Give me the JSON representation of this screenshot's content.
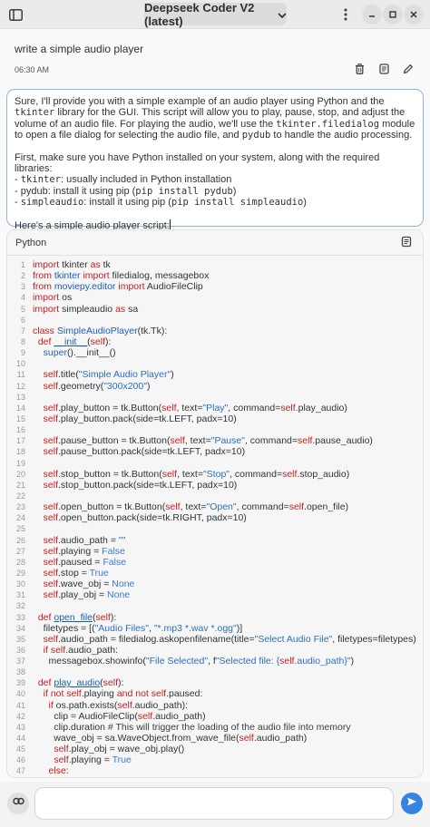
{
  "header": {
    "model_label": "Deepseek Coder V2 (latest)"
  },
  "user_message": {
    "text": "write a simple audio player",
    "time": "06:30 AM"
  },
  "assistant": {
    "p1_a": "Sure, I'll provide you with a simple example of an audio player using Python and the ",
    "p1_b": "tkinter",
    "p1_c": " library for the GUI. This script will allow you to play, pause, stop, and adjust the volume of an audio file. For playing the audio, we'll use the ",
    "p1_d": "tkinter.filedialog",
    "p1_e": " module to open a file dialog for selecting the audio file, and ",
    "p1_f": "pydub",
    "p1_g": " to handle the audio processing.",
    "p2": "First, make sure you have Python installed on your system, along with the required libraries:",
    "b1_a": "- ",
    "b1_b": "tkinter",
    "b1_c": ": usually included in Python installation",
    "b2_a": "- pydub: install it using pip (",
    "b2_b": "pip install pydub",
    "b2_c": ")",
    "b3_a": "- ",
    "b3_b": "simpleaudio",
    "b3_c": ": install it using pip (",
    "b3_d": "pip install simpleaudio",
    "b3_e": ")",
    "p3": "Here's a simple audio player script:"
  },
  "code_block": {
    "language": "Python",
    "lines": [
      [
        [
          "k",
          "import"
        ],
        [
          "p",
          " tkinter "
        ],
        [
          "k",
          "as"
        ],
        [
          "p",
          " tk"
        ]
      ],
      [
        [
          "k",
          "from"
        ],
        [
          "p",
          " "
        ],
        [
          "t",
          "tkinter"
        ],
        [
          "p",
          " "
        ],
        [
          "k",
          "import"
        ],
        [
          "p",
          " filedialog, messagebox"
        ]
      ],
      [
        [
          "k",
          "from"
        ],
        [
          "p",
          " "
        ],
        [
          "t",
          "moviepy.editor"
        ],
        [
          "p",
          " "
        ],
        [
          "k",
          "import"
        ],
        [
          "p",
          " AudioFileClip"
        ]
      ],
      [
        [
          "k",
          "import"
        ],
        [
          "p",
          " os"
        ]
      ],
      [
        [
          "k",
          "import"
        ],
        [
          "p",
          " simpleaudio "
        ],
        [
          "k",
          "as"
        ],
        [
          "p",
          " sa"
        ]
      ],
      [],
      [
        [
          "k",
          "class"
        ],
        [
          "p",
          " "
        ],
        [
          "t",
          "SimpleAudioPlayer"
        ],
        [
          "p",
          "(tk.Tk):"
        ]
      ],
      [
        [
          "p",
          "  "
        ],
        [
          "k",
          "def"
        ],
        [
          "p",
          " "
        ],
        [
          "fname",
          "__init__"
        ],
        [
          "p",
          "("
        ],
        [
          "k",
          "self"
        ],
        [
          "p",
          "):"
        ]
      ],
      [
        [
          "p",
          "    "
        ],
        [
          "fn",
          "super"
        ],
        [
          "p",
          "().__init__()"
        ]
      ],
      [],
      [
        [
          "p",
          "    "
        ],
        [
          "k",
          "self"
        ],
        [
          "p",
          ".title("
        ],
        [
          "s",
          "\"Simple Audio Player\""
        ],
        [
          "p",
          ")"
        ]
      ],
      [
        [
          "p",
          "    "
        ],
        [
          "k",
          "self"
        ],
        [
          "p",
          ".geometry("
        ],
        [
          "s",
          "\"300x200\""
        ],
        [
          "p",
          ")"
        ]
      ],
      [],
      [
        [
          "p",
          "    "
        ],
        [
          "k",
          "self"
        ],
        [
          "p",
          ".play_button = tk.Button("
        ],
        [
          "k",
          "self"
        ],
        [
          "p",
          ", text="
        ],
        [
          "s",
          "\"Play\""
        ],
        [
          "p",
          ", command="
        ],
        [
          "k",
          "self"
        ],
        [
          "p",
          ".play_audio)"
        ]
      ],
      [
        [
          "p",
          "    "
        ],
        [
          "k",
          "self"
        ],
        [
          "p",
          ".play_button.pack(side=tk.LEFT, padx=10)"
        ]
      ],
      [],
      [
        [
          "p",
          "    "
        ],
        [
          "k",
          "self"
        ],
        [
          "p",
          ".pause_button = tk.Button("
        ],
        [
          "k",
          "self"
        ],
        [
          "p",
          ", text="
        ],
        [
          "s",
          "\"Pause\""
        ],
        [
          "p",
          ", command="
        ],
        [
          "k",
          "self"
        ],
        [
          "p",
          ".pause_audio)"
        ]
      ],
      [
        [
          "p",
          "    "
        ],
        [
          "k",
          "self"
        ],
        [
          "p",
          ".pause_button.pack(side=tk.LEFT, padx=10)"
        ]
      ],
      [],
      [
        [
          "p",
          "    "
        ],
        [
          "k",
          "self"
        ],
        [
          "p",
          ".stop_button = tk.Button("
        ],
        [
          "k",
          "self"
        ],
        [
          "p",
          ", text="
        ],
        [
          "s",
          "\"Stop\""
        ],
        [
          "p",
          ", command="
        ],
        [
          "k",
          "self"
        ],
        [
          "p",
          ".stop_audio)"
        ]
      ],
      [
        [
          "p",
          "    "
        ],
        [
          "k",
          "self"
        ],
        [
          "p",
          ".stop_button.pack(side=tk.LEFT, padx=10)"
        ]
      ],
      [],
      [
        [
          "p",
          "    "
        ],
        [
          "k",
          "self"
        ],
        [
          "p",
          ".open_button = tk.Button("
        ],
        [
          "k",
          "self"
        ],
        [
          "p",
          ", text="
        ],
        [
          "s",
          "\"Open\""
        ],
        [
          "p",
          ", command="
        ],
        [
          "k",
          "self"
        ],
        [
          "p",
          ".open_file)"
        ]
      ],
      [
        [
          "p",
          "    "
        ],
        [
          "k",
          "self"
        ],
        [
          "p",
          ".open_button.pack(side=tk.RIGHT, padx=10)"
        ]
      ],
      [],
      [
        [
          "p",
          "    "
        ],
        [
          "k",
          "self"
        ],
        [
          "p",
          ".audio_path = "
        ],
        [
          "s",
          "\"\""
        ]
      ],
      [
        [
          "p",
          "    "
        ],
        [
          "k",
          "self"
        ],
        [
          "p",
          ".playing = "
        ],
        [
          "n",
          "False"
        ]
      ],
      [
        [
          "p",
          "    "
        ],
        [
          "k",
          "self"
        ],
        [
          "p",
          ".paused = "
        ],
        [
          "n",
          "False"
        ]
      ],
      [
        [
          "p",
          "    "
        ],
        [
          "k",
          "self"
        ],
        [
          "p",
          ".stop = "
        ],
        [
          "n",
          "True"
        ]
      ],
      [
        [
          "p",
          "    "
        ],
        [
          "k",
          "self"
        ],
        [
          "p",
          ".wave_obj = "
        ],
        [
          "n",
          "None"
        ]
      ],
      [
        [
          "p",
          "    "
        ],
        [
          "k",
          "self"
        ],
        [
          "p",
          ".play_obj = "
        ],
        [
          "n",
          "None"
        ]
      ],
      [],
      [
        [
          "p",
          "  "
        ],
        [
          "k",
          "def"
        ],
        [
          "p",
          " "
        ],
        [
          "fname",
          "open_file"
        ],
        [
          "p",
          "("
        ],
        [
          "k",
          "self"
        ],
        [
          "p",
          "):"
        ]
      ],
      [
        [
          "p",
          "    filetypes = [("
        ],
        [
          "s",
          "\"Audio Files\""
        ],
        [
          "p",
          ", "
        ],
        [
          "s",
          "\"*.mp3 *.wav *.ogg\""
        ],
        [
          "p",
          ")]"
        ]
      ],
      [
        [
          "p",
          "    "
        ],
        [
          "k",
          "self"
        ],
        [
          "p",
          ".audio_path = filedialog.askopenfilename(title="
        ],
        [
          "s",
          "\"Select Audio File\""
        ],
        [
          "p",
          ", filetypes=filetypes)"
        ]
      ],
      [
        [
          "p",
          "    "
        ],
        [
          "k",
          "if self"
        ],
        [
          "p",
          ".audio_path:"
        ]
      ],
      [
        [
          "p",
          "      messagebox.showinfo("
        ],
        [
          "s",
          "\"File Selected\""
        ],
        [
          "p",
          ", f"
        ],
        [
          "s",
          "\"Selected file: {"
        ],
        [
          "k",
          "self"
        ],
        [
          "s",
          ".audio_path}\""
        ],
        [
          "p",
          ")"
        ]
      ],
      [],
      [
        [
          "p",
          "  "
        ],
        [
          "k",
          "def"
        ],
        [
          "p",
          " "
        ],
        [
          "fname",
          "play_audio"
        ],
        [
          "p",
          "("
        ],
        [
          "k",
          "self"
        ],
        [
          "p",
          "):"
        ]
      ],
      [
        [
          "p",
          "    "
        ],
        [
          "k",
          "if not self"
        ],
        [
          "p",
          ".playing "
        ],
        [
          "k",
          "and not self"
        ],
        [
          "p",
          ".paused:"
        ]
      ],
      [
        [
          "p",
          "      "
        ],
        [
          "k",
          "if"
        ],
        [
          "p",
          " os.path.exists("
        ],
        [
          "k",
          "self"
        ],
        [
          "p",
          ".audio_path):"
        ]
      ],
      [
        [
          "p",
          "        clip = AudioFileClip("
        ],
        [
          "k",
          "self"
        ],
        [
          "p",
          ".audio_path)"
        ]
      ],
      [
        [
          "p",
          "        clip.duration "
        ],
        [
          "c",
          "# This will trigger the loading of the audio file into memory"
        ]
      ],
      [
        [
          "p",
          "        wave_obj = sa.WaveObject.from_wave_file("
        ],
        [
          "k",
          "self"
        ],
        [
          "p",
          ".audio_path)"
        ]
      ],
      [
        [
          "p",
          "        "
        ],
        [
          "k",
          "self"
        ],
        [
          "p",
          ".play_obj = wave_obj.play()"
        ]
      ],
      [
        [
          "p",
          "        "
        ],
        [
          "k",
          "self"
        ],
        [
          "p",
          ".playing = "
        ],
        [
          "n",
          "True"
        ]
      ],
      [
        [
          "p",
          "      "
        ],
        [
          "k",
          "else"
        ],
        [
          "p",
          ":"
        ]
      ]
    ]
  },
  "composer": {
    "placeholder": ""
  }
}
